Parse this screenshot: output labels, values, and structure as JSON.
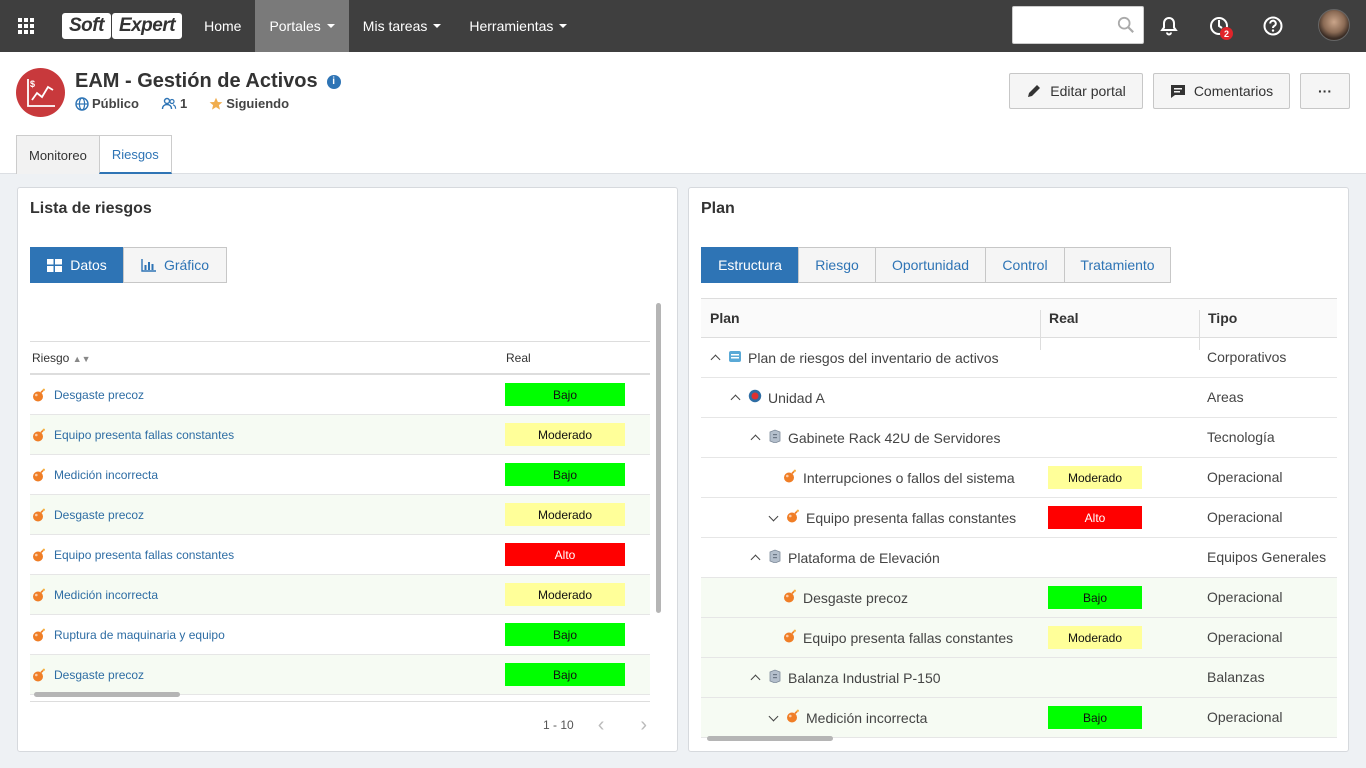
{
  "topbar": {
    "logo_part1": "Soft",
    "logo_part2": "Expert",
    "nav": [
      {
        "label": "Home",
        "dropdown": false,
        "active": false
      },
      {
        "label": "Portales",
        "dropdown": true,
        "active": true
      },
      {
        "label": "Mis tareas",
        "dropdown": true,
        "active": false
      },
      {
        "label": "Herramientas",
        "dropdown": true,
        "active": false
      }
    ],
    "search_placeholder": "",
    "notifications_badge": "2"
  },
  "portal": {
    "title": "EAM - Gestión de Activos",
    "visibility": "Público",
    "members": "1",
    "following": "Siguiendo",
    "edit_button": "Editar portal",
    "comments_button": "Comentarios",
    "more_button": "···"
  },
  "tabs": [
    "Monitoreo",
    "Riesgos"
  ],
  "risk_list": {
    "title": "Lista de riesgos",
    "view_buttons": [
      "Datos",
      "Gráfico"
    ],
    "col_risk": "Riesgo",
    "col_real": "Real",
    "rows": [
      {
        "name": "Desgaste precoz",
        "level": "Bajo"
      },
      {
        "name": "Equipo presenta fallas constantes",
        "level": "Moderado"
      },
      {
        "name": "Medición incorrecta",
        "level": "Bajo"
      },
      {
        "name": "Desgaste precoz",
        "level": "Moderado"
      },
      {
        "name": "Equipo presenta fallas constantes",
        "level": "Alto"
      },
      {
        "name": "Medición incorrecta",
        "level": "Moderado"
      },
      {
        "name": "Ruptura de maquinaria y equipo",
        "level": "Bajo"
      },
      {
        "name": "Desgaste precoz",
        "level": "Bajo"
      }
    ],
    "pagination": "1 - 10"
  },
  "plan": {
    "title": "Plan",
    "view_buttons": [
      "Estructura",
      "Riesgo",
      "Oportunidad",
      "Control",
      "Tratamiento"
    ],
    "columns": [
      "Plan",
      "Real",
      "Tipo"
    ],
    "rows": [
      {
        "name": "Plan de riesgos del inventario de activos",
        "real": "",
        "tipo": "Corporativos"
      },
      {
        "name": "Unidad A",
        "real": "",
        "tipo": "Areas"
      },
      {
        "name": "Gabinete Rack 42U de Servidores",
        "real": "",
        "tipo": "Tecnología"
      },
      {
        "name": "Interrupciones o fallos del sistema",
        "real": "Moderado",
        "tipo": "Operacional"
      },
      {
        "name": "Equipo presenta fallas constantes",
        "real": "Alto",
        "tipo": "Operacional"
      },
      {
        "name": "Plataforma de Elevación",
        "real": "",
        "tipo": "Equipos Generales"
      },
      {
        "name": "Desgaste precoz",
        "real": "Bajo",
        "tipo": "Operacional"
      },
      {
        "name": "Equipo presenta fallas constantes",
        "real": "Moderado",
        "tipo": "Operacional"
      },
      {
        "name": "Balanza Industrial P-150",
        "real": "",
        "tipo": "Balanzas"
      },
      {
        "name": "Medición incorrecta",
        "real": "Bajo",
        "tipo": "Operacional"
      }
    ]
  },
  "colors": {
    "topbar": "#3f3f3f",
    "accent": "#2e74b5",
    "bajo": "#00ff00",
    "moderado": "#ffff99",
    "alto": "#ff0000",
    "portal_icon": "#c8393c"
  }
}
